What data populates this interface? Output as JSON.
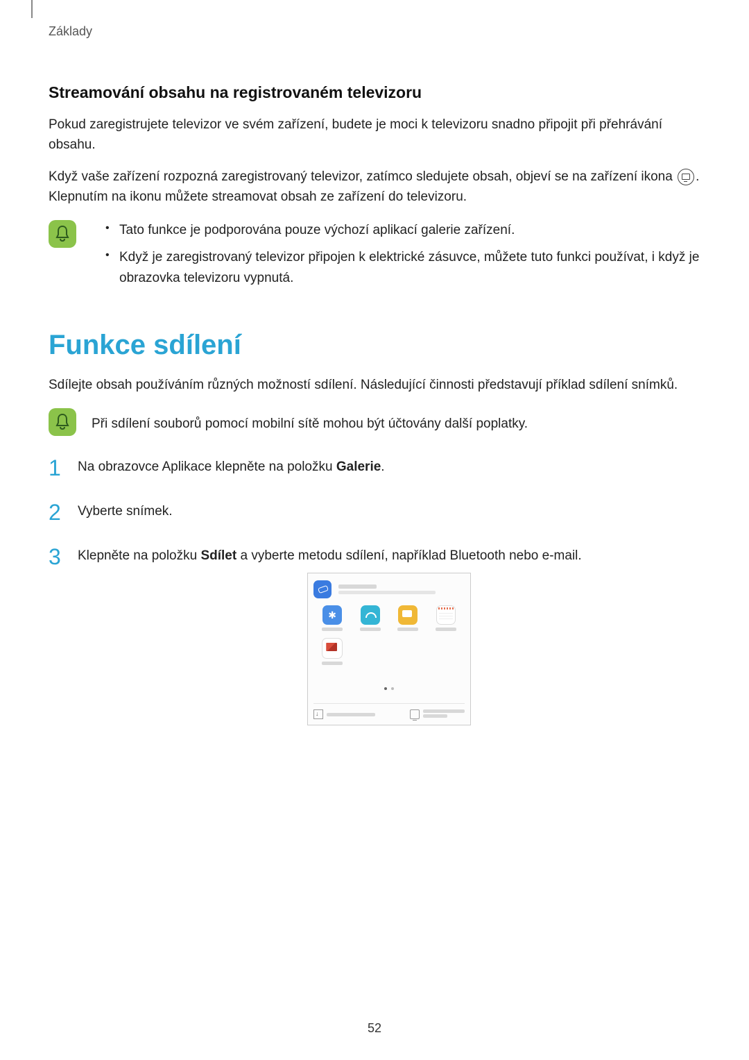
{
  "breadcrumb": "Základy",
  "section1": {
    "heading": "Streamování obsahu na registrovaném televizoru",
    "p1": "Pokud zaregistrujete televizor ve svém zařízení, budete je moci k televizoru snadno připojit při přehrávání obsahu.",
    "p2a": "Když vaše zařízení rozpozná zaregistrovaný televizor, zatímco sledujete obsah, objeví se na zařízení ikona ",
    "p2b": ". Klepnutím na ikonu můžete streamovat obsah ze zařízení do televizoru.",
    "note_items": [
      "Tato funkce je podporována pouze výchozí aplikací galerie zařízení.",
      "Když je zaregistrovaný televizor připojen k elektrické zásuvce, můžete tuto funkci používat, i když je obrazovka televizoru vypnutá."
    ]
  },
  "section2": {
    "heading": "Funkce sdílení",
    "intro": "Sdílejte obsah používáním různých možností sdílení. Následující činnosti představují příklad sdílení snímků.",
    "note": "Při sdílení souborů pomocí mobilní sítě mohou být účtovány další poplatky.",
    "steps": {
      "s1a": "Na obrazovce Aplikace klepněte na položku ",
      "s1b": "Galerie",
      "s1c": ".",
      "s2": "Vyberte snímek.",
      "s3a": "Klepněte na položku ",
      "s3b": "Sdílet",
      "s3c": " a vyberte metodu sdílení, například Bluetooth nebo e-mail."
    }
  },
  "page_number": "52"
}
